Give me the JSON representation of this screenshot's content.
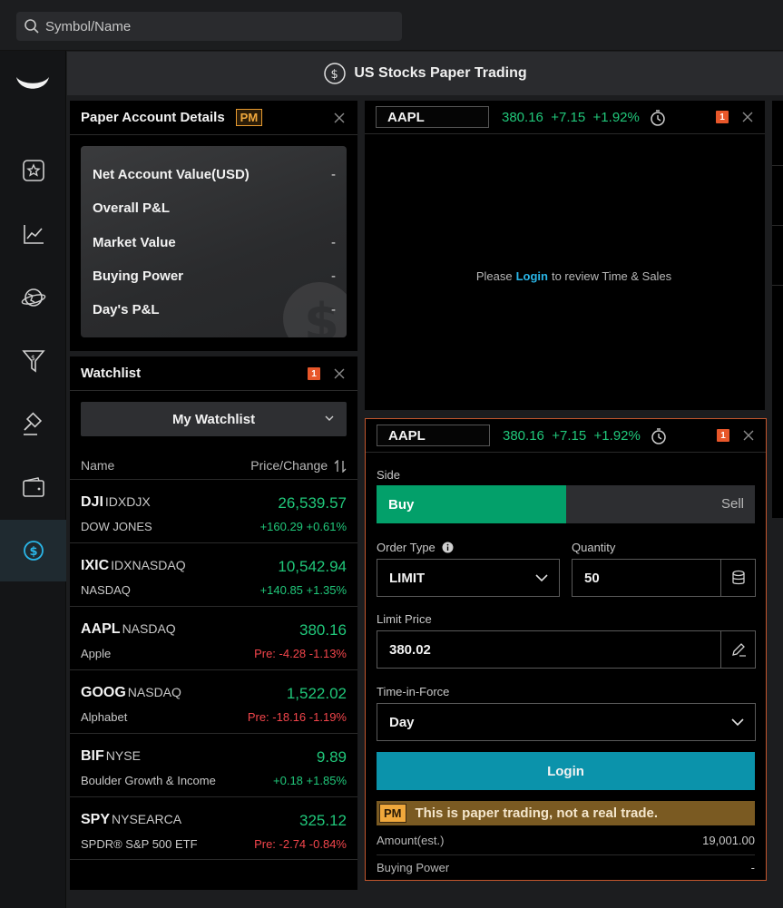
{
  "search": {
    "placeholder": "Symbol/Name"
  },
  "header": {
    "title": "US Stocks Paper Trading"
  },
  "account": {
    "title": "Paper Account Details",
    "pm_tag": "PM",
    "rows": [
      {
        "label": "Net Account Value(USD)",
        "value": "-"
      },
      {
        "label": "Overall P&L",
        "value": ""
      },
      {
        "label": "Market Value",
        "value": "-"
      },
      {
        "label": "Buying Power",
        "value": "-"
      },
      {
        "label": "Day's P&L",
        "value": "-"
      }
    ]
  },
  "watchlist": {
    "title": "Watchlist",
    "badge": "1",
    "selected": "My Watchlist",
    "col_name": "Name",
    "col_price": "Price/Change",
    "rows": [
      {
        "symbol": "DJI",
        "exchange": "IDXDJX",
        "name": "DOW JONES",
        "price": "26,539.57",
        "change": "+160.29",
        "pct": "+0.61%",
        "pre": "",
        "dir": "up"
      },
      {
        "symbol": "IXIC",
        "exchange": "IDXNASDAQ",
        "name": "NASDAQ",
        "price": "10,542.94",
        "change": "+140.85",
        "pct": "+1.35%",
        "pre": "",
        "dir": "up"
      },
      {
        "symbol": "AAPL",
        "exchange": "NASDAQ",
        "name": "Apple",
        "price": "380.16",
        "change": "-4.28",
        "pct": "-1.13%",
        "pre": "Pre:",
        "dir": "down"
      },
      {
        "symbol": "GOOG",
        "exchange": "NASDAQ",
        "name": "Alphabet",
        "price": "1,522.02",
        "change": "-18.16",
        "pct": "-1.19%",
        "pre": "Pre:",
        "dir": "down"
      },
      {
        "symbol": "BIF",
        "exchange": "NYSE",
        "name": "Boulder Growth & Income",
        "price": "9.89",
        "change": "+0.18",
        "pct": "+1.85%",
        "pre": "",
        "dir": "up"
      },
      {
        "symbol": "SPY",
        "exchange": "NYSEARCA",
        "name": "SPDR® S&P 500 ETF",
        "price": "325.12",
        "change": "-2.74",
        "pct": "-0.84%",
        "pre": "Pre:",
        "dir": "down"
      }
    ]
  },
  "time_sales": {
    "symbol": "AAPL",
    "price": "380.16",
    "change": "+7.15",
    "pct": "+1.92%",
    "badge": "1",
    "msg_pre": "Please",
    "msg_link": "Login",
    "msg_post": "to review Time & Sales"
  },
  "order": {
    "symbol": "AAPL",
    "price": "380.16",
    "change": "+7.15",
    "pct": "+1.92%",
    "badge": "1",
    "side_label": "Side",
    "buy": "Buy",
    "sell": "Sell",
    "order_type_label": "Order Type",
    "order_type": "LIMIT",
    "quantity_label": "Quantity",
    "quantity": "50",
    "limit_price_label": "Limit Price",
    "limit_price": "380.02",
    "tif_label": "Time-in-Force",
    "tif": "Day",
    "login": "Login",
    "paper_pm": "PM",
    "paper_note": "This is paper trading, not a real trade.",
    "amount_label": "Amount(est.)",
    "amount": "19,001.00",
    "buying_power_label": "Buying Power",
    "buying_power": "-"
  },
  "colors": {
    "up": "#20c77a",
    "down": "#f2454b",
    "accent": "#0b93ab",
    "buy": "#03a06a",
    "order_border": "#c2562d"
  }
}
